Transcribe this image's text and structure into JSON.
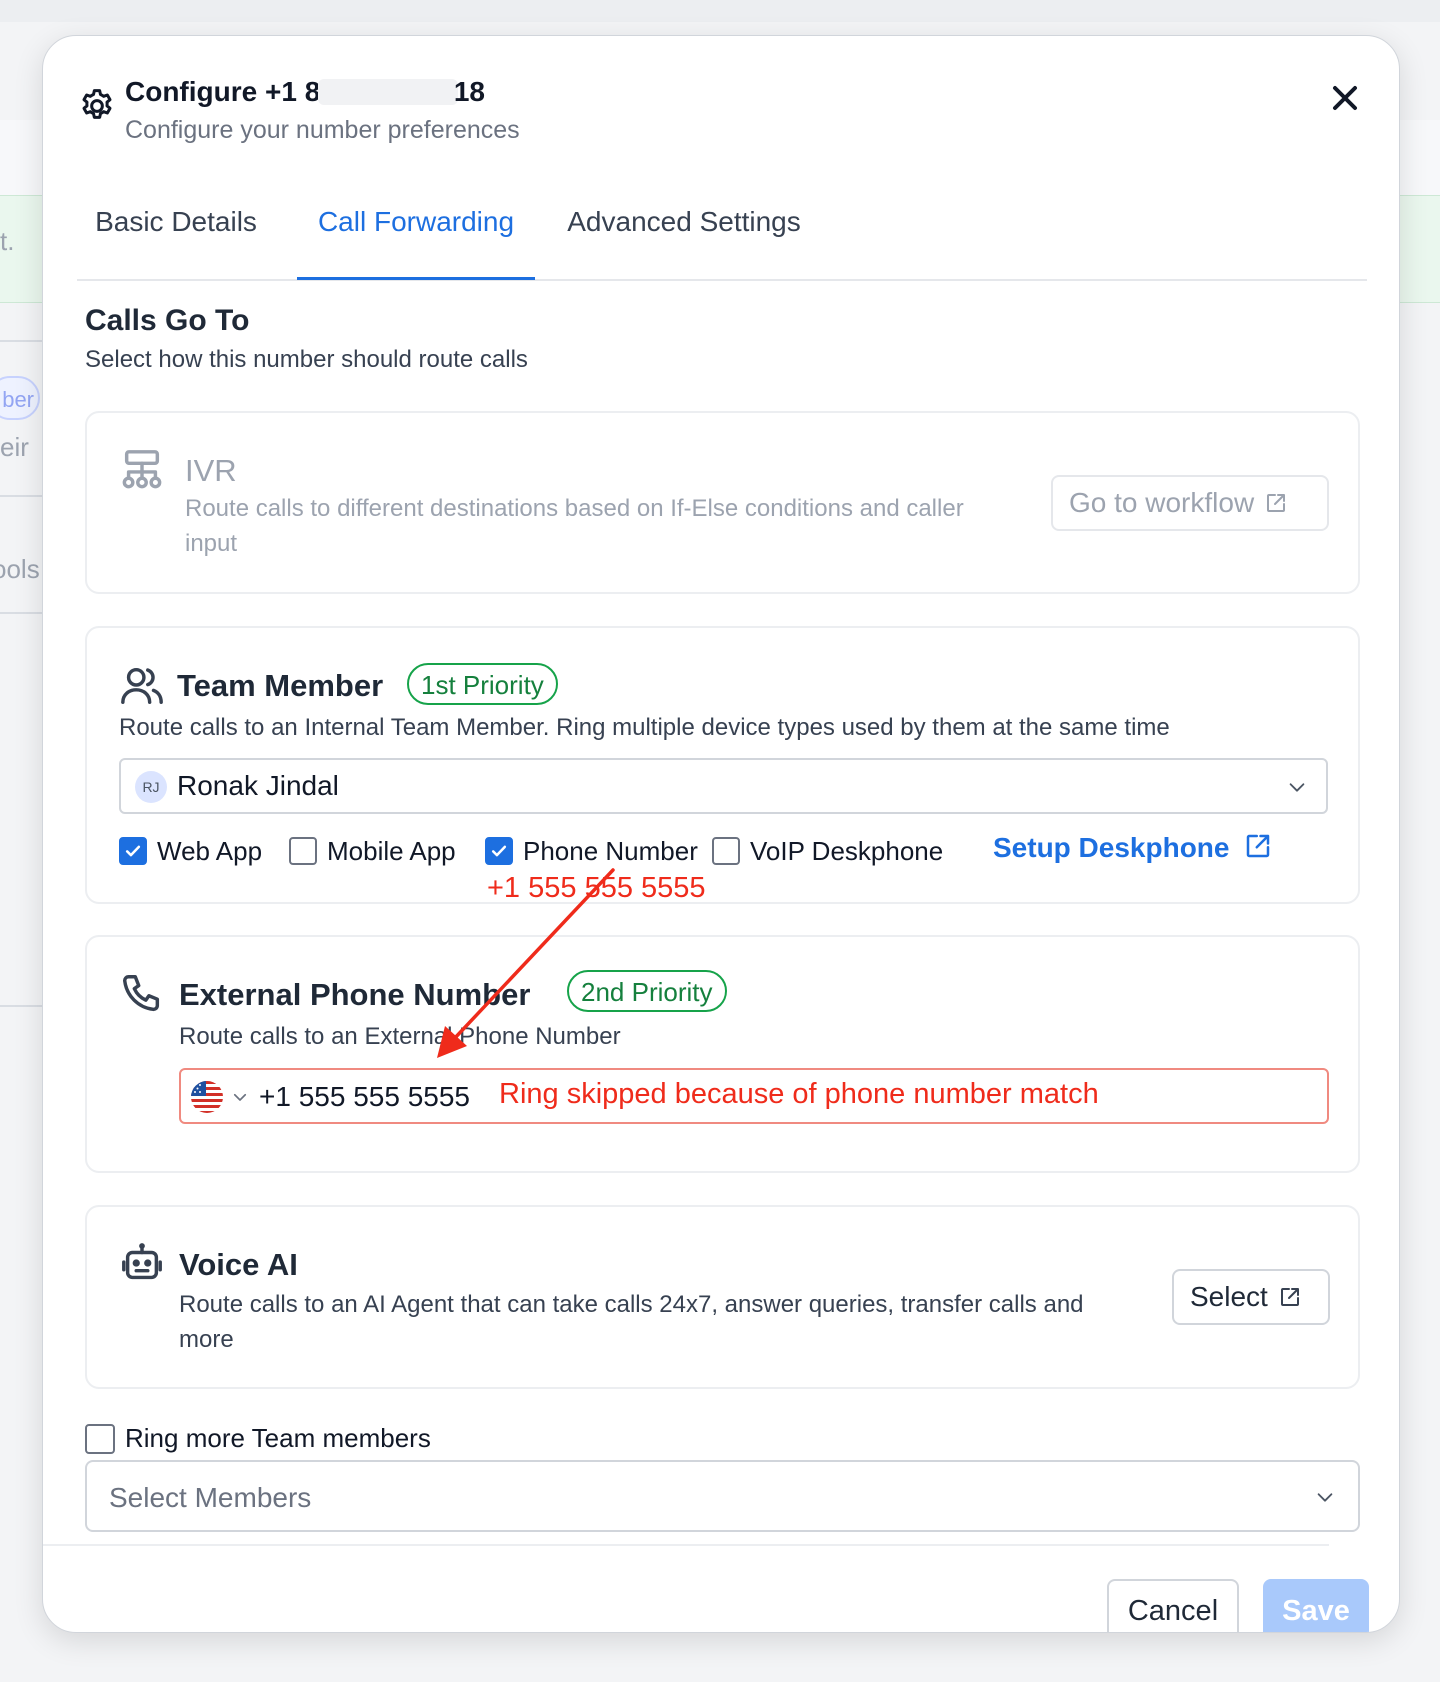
{
  "modal": {
    "title_prefix": "Configure +1 88",
    "title_suffix": "18",
    "subtitle": "Configure your number preferences"
  },
  "tabs": [
    {
      "label": "Basic Details",
      "active": false
    },
    {
      "label": "Call Forwarding",
      "active": true
    },
    {
      "label": "Advanced Settings",
      "active": false
    }
  ],
  "section": {
    "title": "Calls Go To",
    "subtitle": "Select how this number should route calls"
  },
  "ivr": {
    "title": "IVR",
    "description": "Route calls to different destinations based on If-Else conditions and caller input",
    "button": "Go to workflow"
  },
  "team_member": {
    "title": "Team Member",
    "badge": "1st Priority",
    "description": "Route calls to an Internal Team Member. Ring multiple device types used by them at the same time",
    "selected": {
      "initials": "RJ",
      "name": "Ronak Jindal"
    },
    "devices": [
      {
        "label": "Web App",
        "checked": true
      },
      {
        "label": "Mobile App",
        "checked": false
      },
      {
        "label": "Phone Number",
        "checked": true
      },
      {
        "label": "VoIP Deskphone",
        "checked": false
      }
    ],
    "setup_link": "Setup Deskphone",
    "phone_annotation": "+1 555 555 5555"
  },
  "external": {
    "title": "External Phone Number",
    "badge": "2nd Priority",
    "description": "Route calls to an External Phone Number",
    "phone_value": "+1 555 555 5555",
    "error": "Ring skipped because of phone number match"
  },
  "voice_ai": {
    "title": "Voice AI",
    "description": "Route calls to an AI Agent that can take calls 24x7, answer queries, transfer calls and more",
    "button": "Select"
  },
  "ring_more": {
    "label": "Ring more Team members",
    "checked": false,
    "placeholder": "Select Members"
  },
  "footer": {
    "cancel": "Cancel",
    "save": "Save"
  },
  "background_fragments": {
    "a": "t.",
    "b": "ber",
    "c": "eir",
    "d": "ools"
  },
  "colors": {
    "accent": "#1d6fe0",
    "success": "#16a34a",
    "error": "#ef2b1b",
    "save_disabled": "#a9c9fb"
  },
  "icons": [
    "gear-icon",
    "close-icon",
    "ivr-flow-icon",
    "external-link-icon",
    "users-icon",
    "chevron-down-icon",
    "check-icon",
    "phone-icon",
    "us-flag-icon",
    "robot-icon"
  ]
}
